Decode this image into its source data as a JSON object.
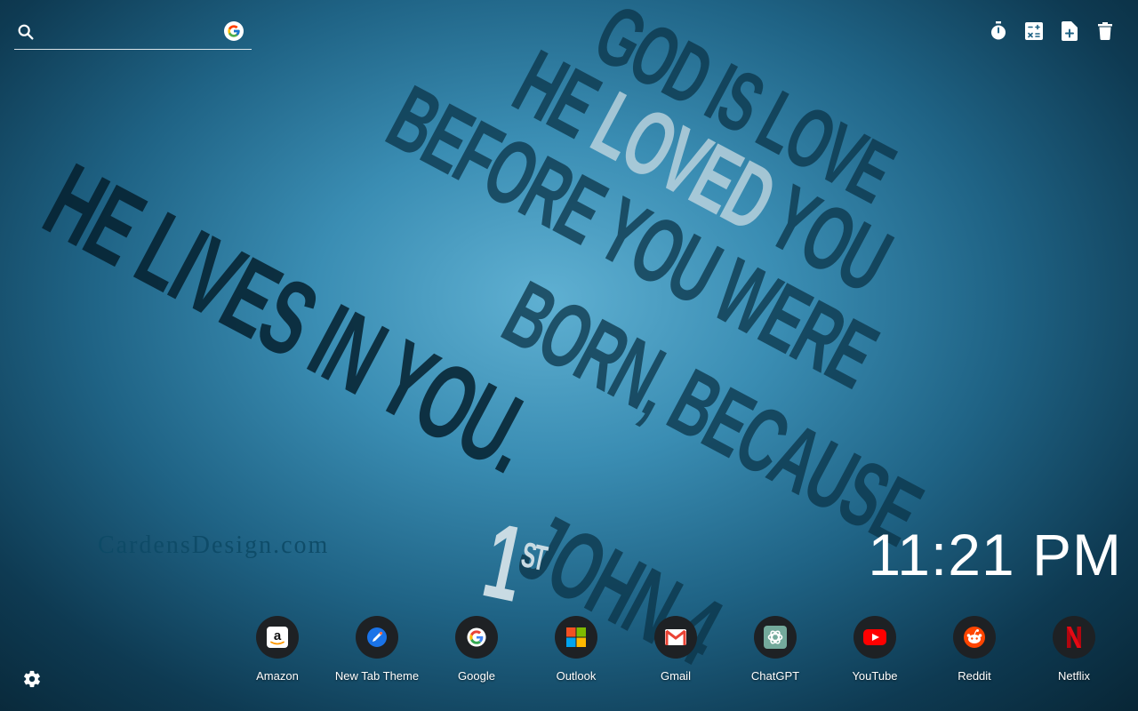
{
  "wallpaper": {
    "lines": [
      "GOD IS LOVE",
      "HE LOVED YOU",
      "BEFORE YOU WERE",
      "BORN, BECAUSE",
      "HE LIVES IN YOU.",
      "1ST JOHN 4"
    ],
    "watermark": "CardensDesign.com"
  },
  "search": {
    "placeholder": "",
    "value": "",
    "engine_icon": "google-icon"
  },
  "toolbar": {
    "tools": [
      {
        "name": "timer-icon"
      },
      {
        "name": "calculator-icon"
      },
      {
        "name": "new-note-icon"
      },
      {
        "name": "trash-icon"
      }
    ]
  },
  "clock": {
    "time": "11:21 PM"
  },
  "shortcuts": [
    {
      "label": "Amazon",
      "icon": "amazon-icon"
    },
    {
      "label": "New Tab Theme",
      "icon": "new-tab-theme-icon"
    },
    {
      "label": "Google",
      "icon": "google-icon"
    },
    {
      "label": "Outlook",
      "icon": "outlook-icon"
    },
    {
      "label": "Gmail",
      "icon": "gmail-icon"
    },
    {
      "label": "ChatGPT",
      "icon": "chatgpt-icon"
    },
    {
      "label": "YouTube",
      "icon": "youtube-icon"
    },
    {
      "label": "Reddit",
      "icon": "reddit-icon"
    },
    {
      "label": "Netflix",
      "icon": "netflix-icon"
    }
  ],
  "settings": {
    "icon": "gear-icon"
  },
  "colors": {
    "accent": "#2f86b1",
    "background_dark": "#082636",
    "text_light": "#ffffff"
  }
}
